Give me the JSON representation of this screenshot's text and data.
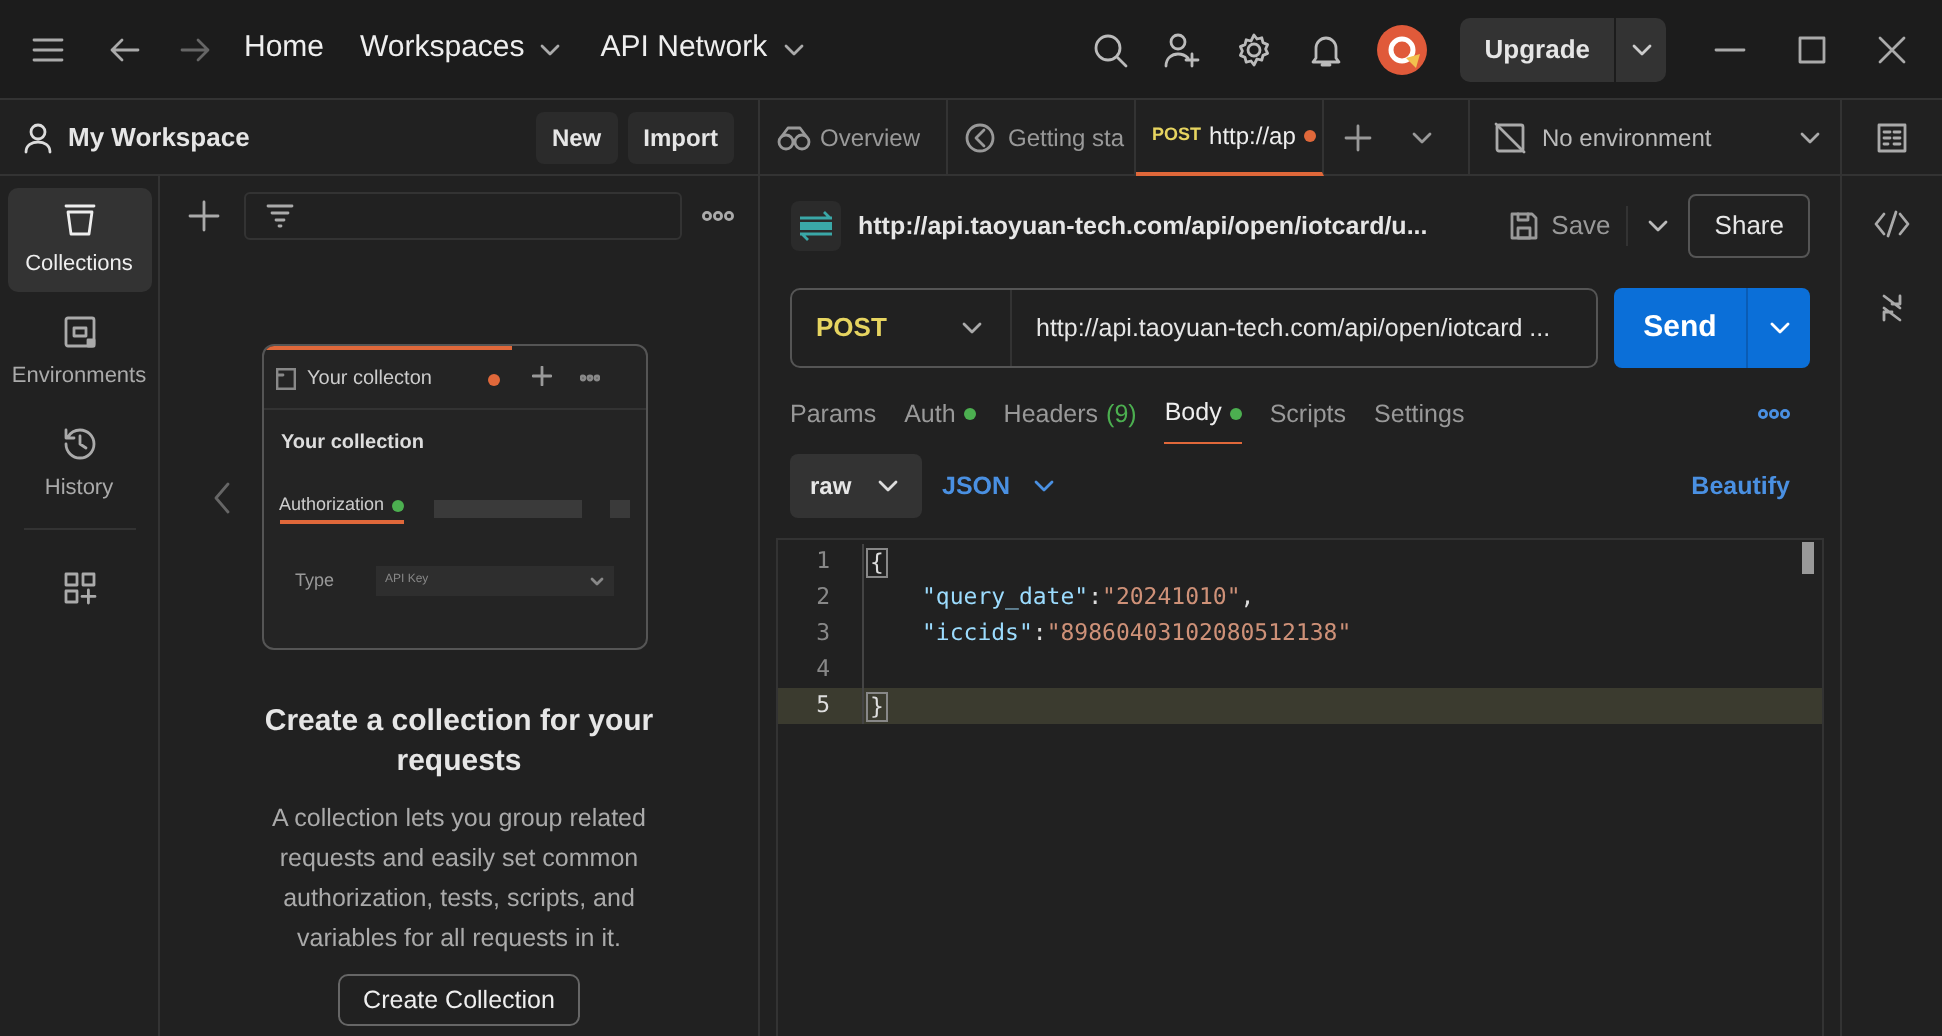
{
  "top_bar": {
    "nav": [
      {
        "label": "Home",
        "dropdown": false
      },
      {
        "label": "Workspaces",
        "dropdown": true
      },
      {
        "label": "API Network",
        "dropdown": true
      }
    ],
    "upgrade": "Upgrade"
  },
  "workspace": {
    "title": "My Workspace",
    "buttons": [
      "New",
      "Import"
    ]
  },
  "rail": [
    {
      "label": "Collections",
      "selected": true
    },
    {
      "label": "Environments",
      "selected": false
    },
    {
      "label": "History",
      "selected": false
    }
  ],
  "empty_state": {
    "preview": {
      "tab": "Your collecton",
      "title": "Your collection",
      "section": "Authorization",
      "field_label": "Type",
      "field_value": "API Key"
    },
    "heading": "Create a collection for your requests",
    "body": "A collection lets you group related requests and easily set common authorization, tests, scripts, and variables for all requests in it.",
    "button": "Create Collection"
  },
  "tabs": [
    {
      "label": "Overview",
      "selected": false
    },
    {
      "label": "Getting sta",
      "selected": false
    },
    {
      "method": "POST",
      "label": "http://ap",
      "modified": true,
      "selected": true
    }
  ],
  "environment": "No environment",
  "request": {
    "title": "http://api.taoyuan-tech.com/api/open/iotcard/u...",
    "save": "Save",
    "share": "Share",
    "method": "POST",
    "url": "http://api.taoyuan-tech.com/api/open/iotcard ...",
    "send": "Send"
  },
  "request_tabs": [
    {
      "label": "Params",
      "dot": false,
      "selected": false
    },
    {
      "label": "Auth",
      "dot": true,
      "selected": false
    },
    {
      "label": "Headers",
      "count": "(9)",
      "dot": false,
      "selected": false
    },
    {
      "label": "Body",
      "dot": true,
      "selected": true
    },
    {
      "label": "Scripts",
      "dot": false,
      "selected": false
    },
    {
      "label": "Settings",
      "dot": false,
      "selected": false
    }
  ],
  "body_mode": "raw",
  "body_format": "JSON",
  "beautify": "Beautify",
  "code_lines": [
    {
      "number": "1",
      "selected": false,
      "tokens": [
        {
          "kind": "brace",
          "text": "{"
        }
      ]
    },
    {
      "number": "2",
      "selected": false,
      "tokens": [
        {
          "kind": "key",
          "text": "\"query_date\""
        },
        {
          "kind": "punct",
          "text": ":"
        },
        {
          "kind": "string",
          "text": "\"20241010\""
        },
        {
          "kind": "punct",
          "text": ","
        }
      ]
    },
    {
      "number": "3",
      "selected": false,
      "tokens": [
        {
          "kind": "key",
          "text": "\"iccids\""
        },
        {
          "kind": "punct",
          "text": ":"
        },
        {
          "kind": "string",
          "text": "\"89860403102080512138\""
        }
      ]
    },
    {
      "number": "4",
      "selected": false
    },
    {
      "number": "5",
      "selected": true,
      "tokens": [
        {
          "kind": "brace",
          "text": "}"
        }
      ]
    }
  ]
}
